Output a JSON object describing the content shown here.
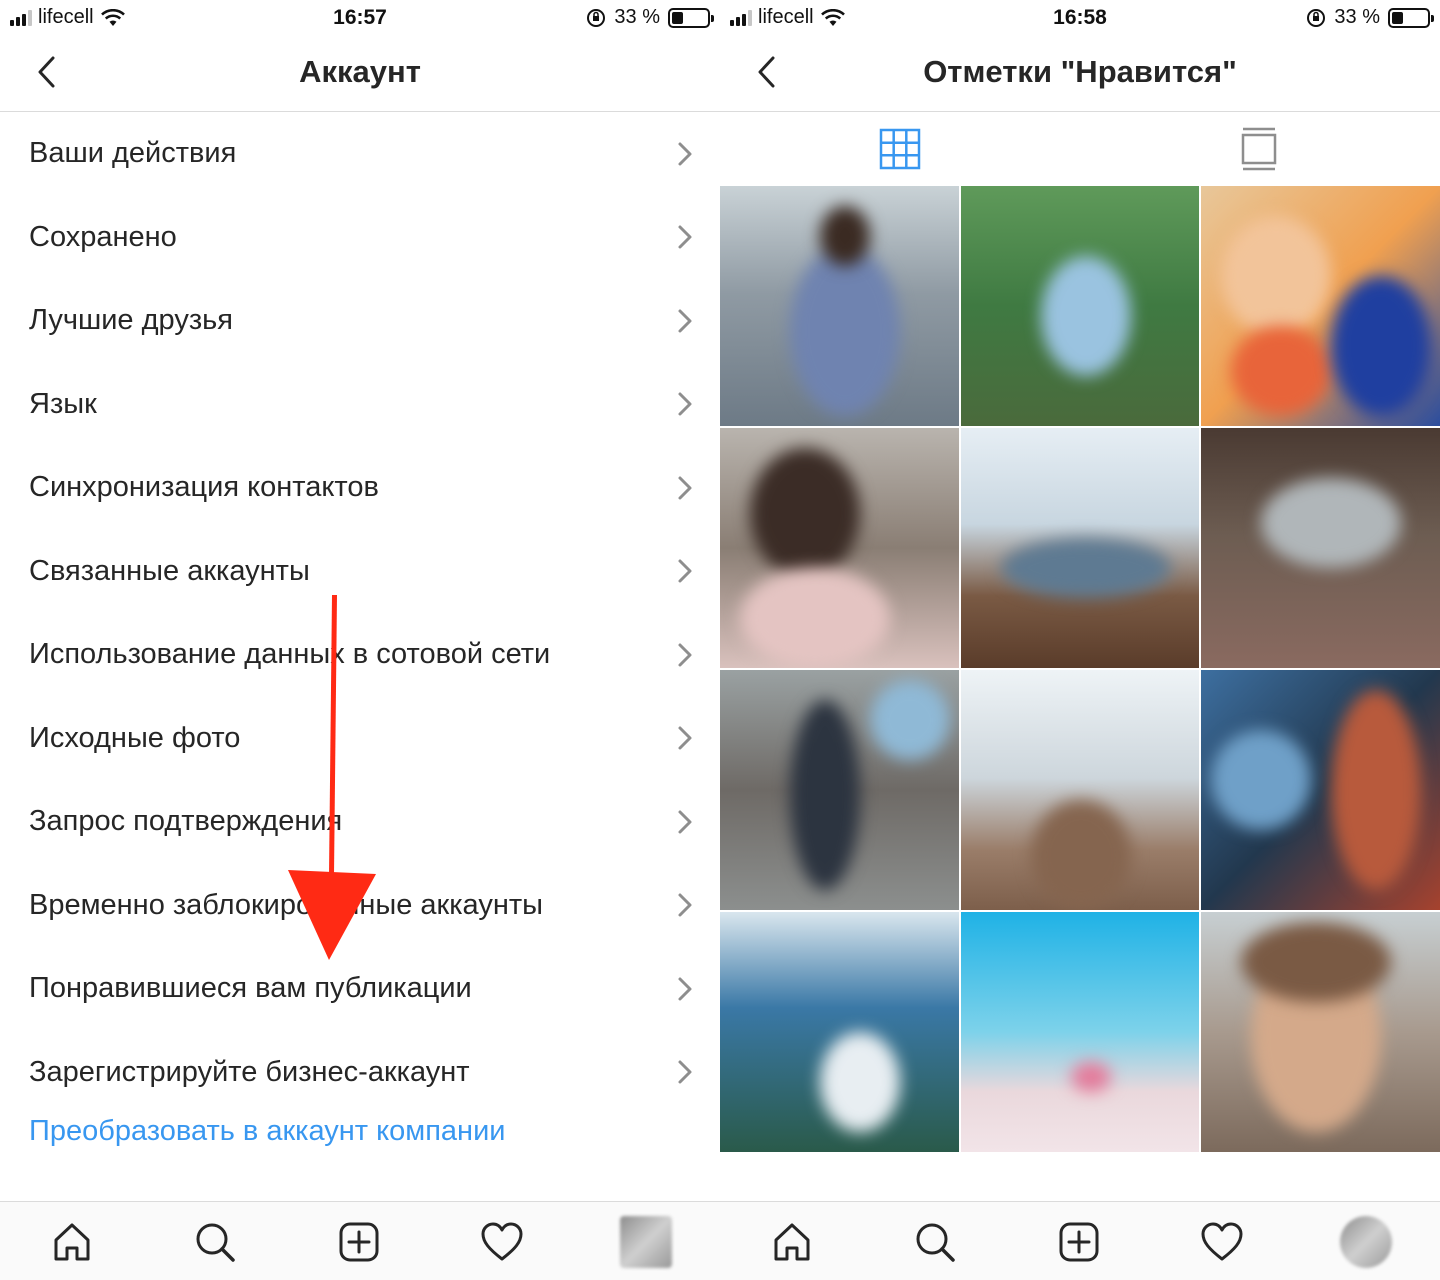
{
  "left_screen": {
    "status": {
      "carrier": "lifecell",
      "time": "16:57",
      "battery": "33 %"
    },
    "title": "Аккаунт",
    "menu_items": [
      "Ваши действия",
      "Сохранено",
      "Лучшие друзья",
      "Язык",
      "Синхронизация контактов",
      "Связанные аккаунты",
      "Использование данных в сотовой сети",
      "Исходные фото",
      "Запрос подтверждения",
      "Временно заблокированные аккаунты",
      "Понравившиеся вам публикации",
      "Зарегистрируйте бизнес-аккаунт"
    ],
    "link": "Преобразовать в аккаунт компании"
  },
  "right_screen": {
    "status": {
      "carrier": "lifecell",
      "time": "16:58",
      "battery": "33 %"
    },
    "title": "Отметки \"Нравится\""
  },
  "tabbar_icons": [
    "home-icon",
    "search-icon",
    "add-post-icon",
    "activity-heart-icon",
    "profile-avatar"
  ],
  "colors": {
    "link": "#3897f0",
    "grid_active": "#3897f0",
    "annotation_arrow": "#ff2a14"
  },
  "battery_level": 0.33
}
